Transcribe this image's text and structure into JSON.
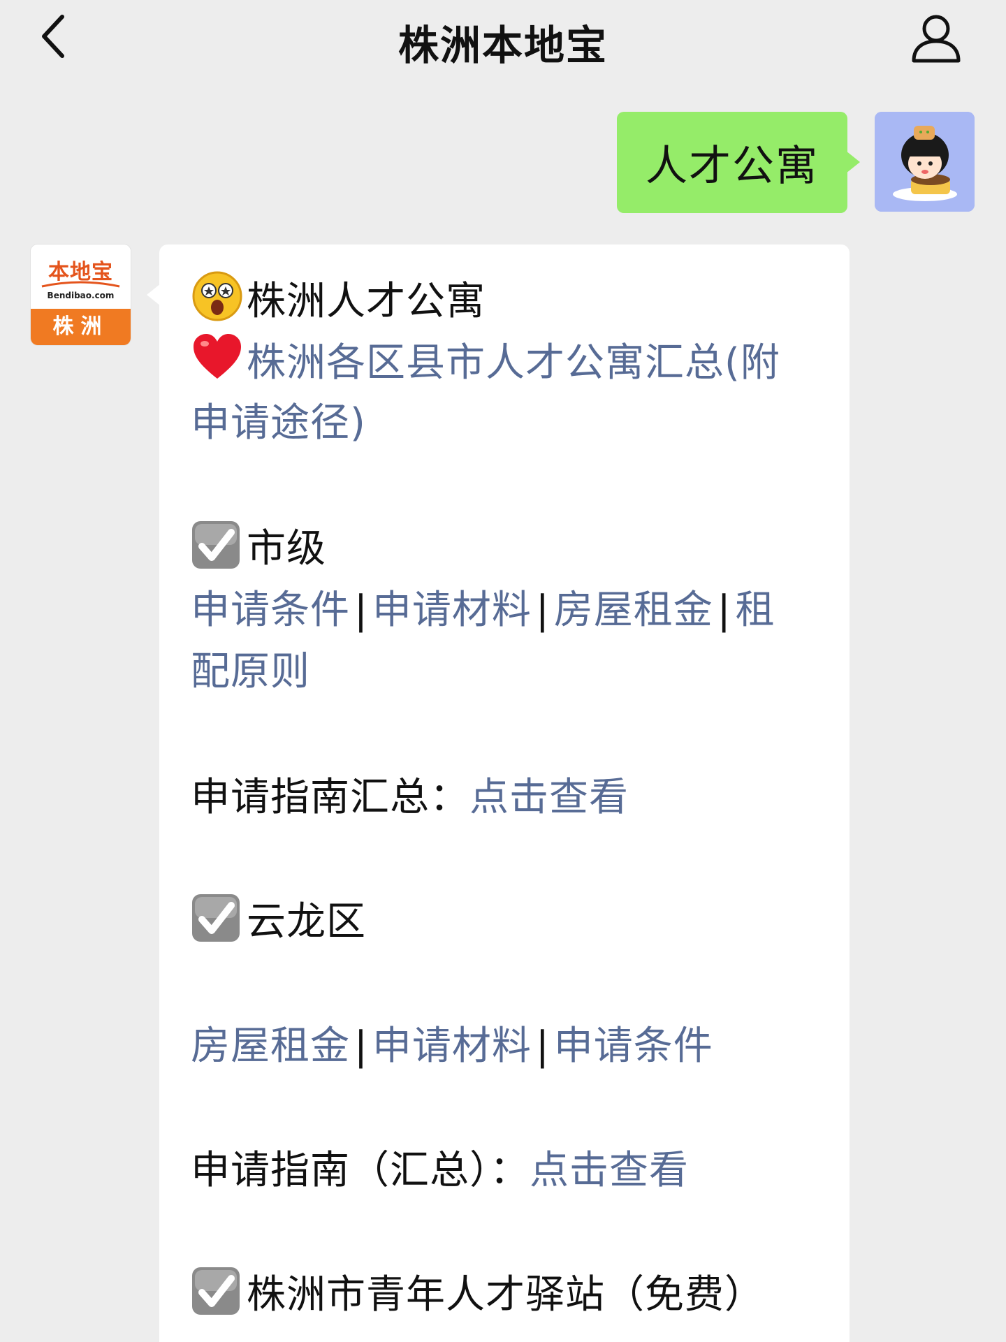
{
  "header": {
    "title": "株洲本地宝"
  },
  "outgoing": {
    "text": "人才公寓"
  },
  "bot": {
    "logo_main": "本地宝",
    "logo_domain": "Bendibao.com",
    "logo_city": "株洲"
  },
  "message": {
    "title": "株洲人才公寓",
    "summary_link_1": "株洲各区县市人才公寓汇总(附",
    "summary_link_2": "申请途径)",
    "city_heading": "市级",
    "city_links": [
      "申请条件",
      "申请材料",
      "房屋租金",
      "租"
    ],
    "city_links_line2": "配原则",
    "separator": "|",
    "guide_label": "申请指南汇总：",
    "guide_link": "点击查看",
    "yunlong_heading": "云龙区",
    "yunlong_links": [
      "房屋租金",
      "申请材料",
      "申请条件"
    ],
    "yunlong_guide_label": "申请指南（汇总）：",
    "yunlong_guide_link": "点击查看",
    "youth_heading": "株洲市青年人才驿站（免费）"
  }
}
